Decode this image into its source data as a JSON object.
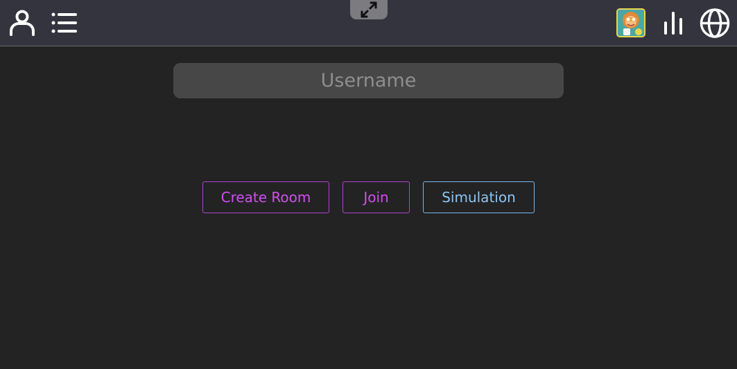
{
  "header": {
    "icons": {
      "profile": "user-icon",
      "menu": "list-icon",
      "fullscreen": "expand-icon",
      "avatar": "avatar",
      "stats": "bar-chart-icon",
      "language": "globe-icon"
    }
  },
  "login": {
    "username_placeholder": "Username",
    "username_value": ""
  },
  "actions": {
    "create_room_label": "Create Room",
    "join_label": "Join",
    "simulation_label": "Simulation"
  },
  "colors": {
    "background": "#232323",
    "topbar": "#34343f",
    "room_accent": "#d04ff0",
    "simulation_accent": "#8cc4f6"
  }
}
